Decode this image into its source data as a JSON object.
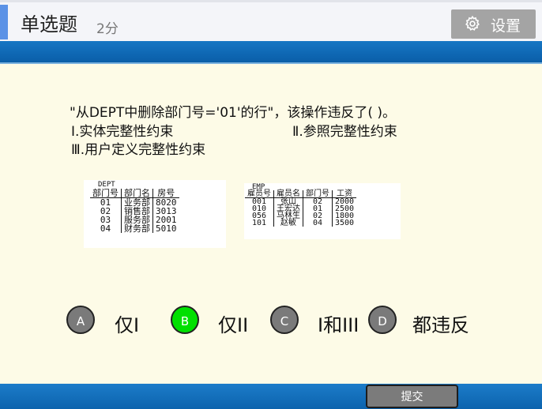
{
  "header": {
    "title": "单选题",
    "score": "2分",
    "settings_label": "设置",
    "settings_icon": "gear-icon"
  },
  "question": {
    "stem": "\"从DEPT中删除部门号='01'的行\"，该操作违反了(      )。",
    "items": [
      "Ⅰ.实体完整性约束",
      "Ⅱ.参照完整性约束",
      "Ⅲ.用户定义完整性约束"
    ]
  },
  "dept_table": {
    "name": "DEPT",
    "headers": [
      "部门号",
      "部门名",
      "房号"
    ],
    "rows": [
      [
        "01",
        "业务部",
        "8020"
      ],
      [
        "02",
        "销售部",
        "3013"
      ],
      [
        "03",
        "服务部",
        "2001"
      ],
      [
        "04",
        "财务部",
        "5010"
      ]
    ]
  },
  "emp_table": {
    "name": "EMP",
    "headers": [
      "雇员号",
      "雇员名",
      "部门号",
      "工资"
    ],
    "rows": [
      [
        "001",
        "张山",
        "02",
        "2000"
      ],
      [
        "010",
        "王宏达",
        "01",
        "2500"
      ],
      [
        "056",
        "马林生",
        "02",
        "1800"
      ],
      [
        "101",
        "赵敏",
        "04",
        "3500"
      ]
    ]
  },
  "options": [
    {
      "letter": "A",
      "text": "仅I",
      "selected": false
    },
    {
      "letter": "B",
      "text": "仅II",
      "selected": true
    },
    {
      "letter": "C",
      "text": "I和III",
      "selected": false
    },
    {
      "letter": "D",
      "text": "都违反",
      "selected": false
    }
  ],
  "selected_color": "#00e000",
  "submit_label": "提交"
}
